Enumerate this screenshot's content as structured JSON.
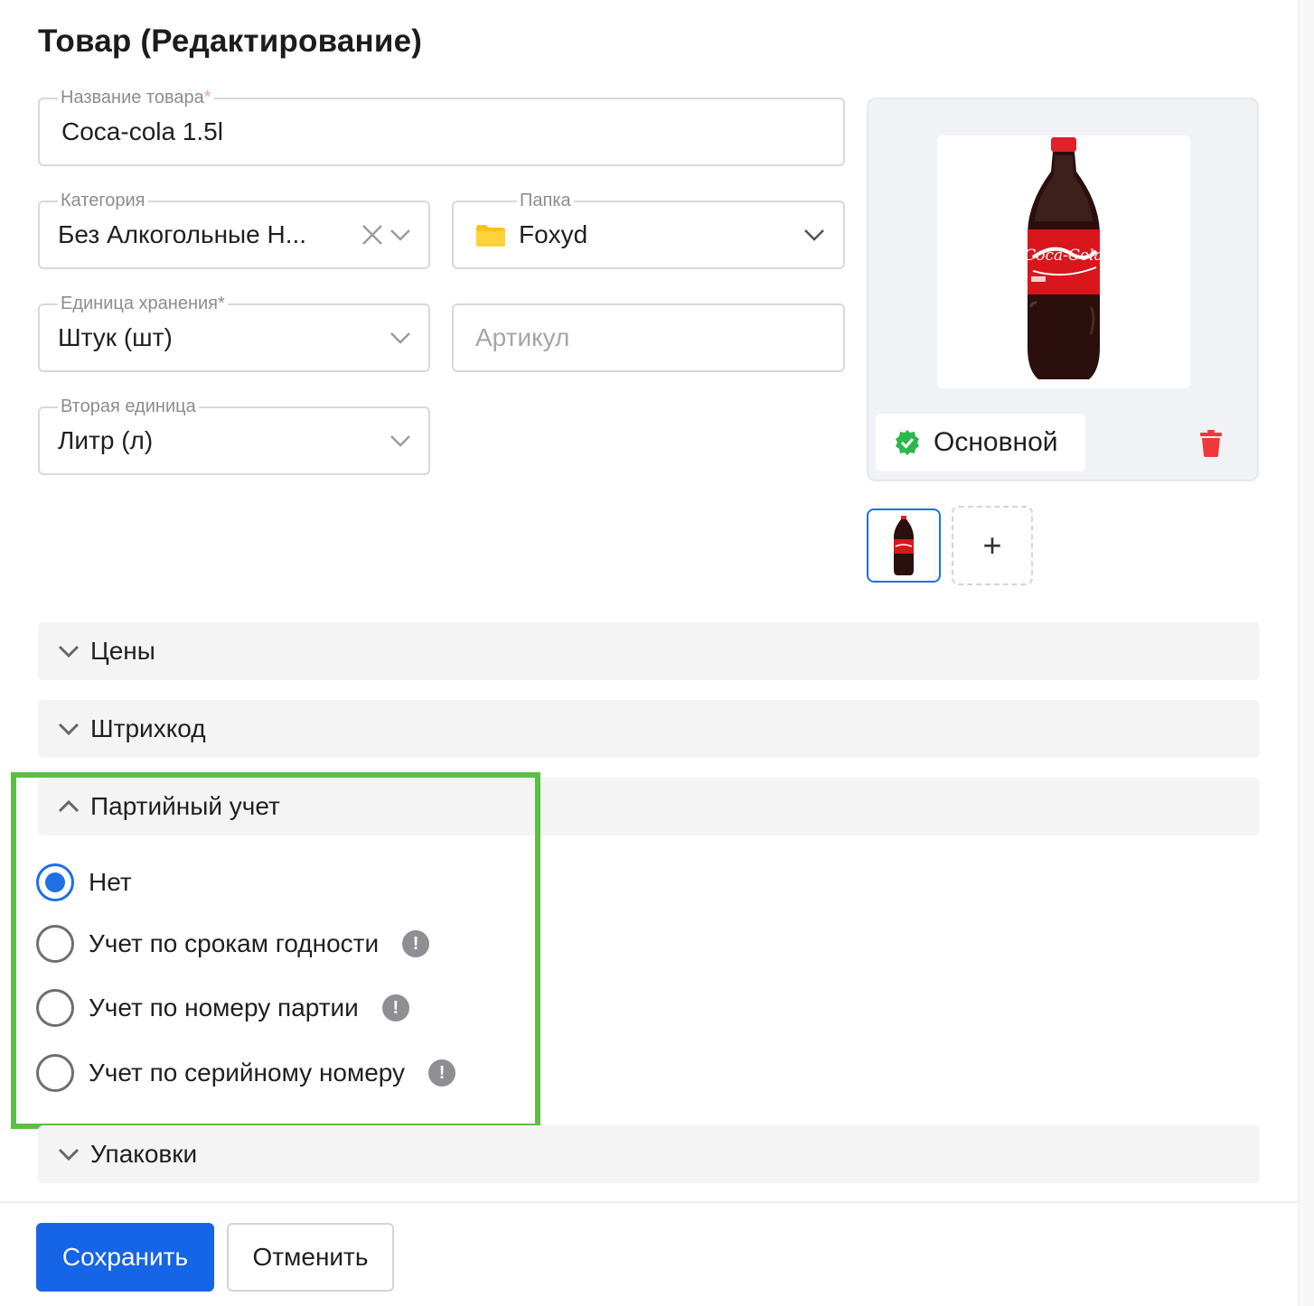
{
  "page": {
    "title": "Товар (Редактирование)"
  },
  "form": {
    "product_name": {
      "label": "Название товара",
      "required_mark": "*",
      "value": "Coca-cola 1.5l"
    },
    "category": {
      "label": "Категория",
      "value": "Без Алкогольные Н..."
    },
    "folder": {
      "label": "Папка",
      "value": "Foxyd",
      "icon": "folder-icon"
    },
    "storage_unit": {
      "label": "Единица хранения",
      "required_mark": "*",
      "value": "Штук (шт)"
    },
    "article": {
      "placeholder": "Артикул",
      "value": ""
    },
    "second_unit": {
      "label": "Вторая единица",
      "value": "Литр (л)"
    }
  },
  "images": {
    "main_badge": "Основной",
    "add_label": "+"
  },
  "sections": [
    {
      "label": "Цены",
      "expanded": false
    },
    {
      "label": "Штрихкод",
      "expanded": false
    },
    {
      "label": "Партийный учет",
      "expanded": true
    },
    {
      "label": "Упаковки",
      "expanded": false
    }
  ],
  "batch_accounting": {
    "options": [
      {
        "label": "Нет",
        "selected": true,
        "info": false
      },
      {
        "label": "Учет по срокам годности",
        "selected": false,
        "info": true
      },
      {
        "label": "Учет по номеру партии",
        "selected": false,
        "info": true
      },
      {
        "label": "Учет по серийному номеру",
        "selected": false,
        "info": true
      }
    ],
    "info_glyph": "!"
  },
  "footer": {
    "save_label": "Сохранить",
    "cancel_label": "Отменить"
  },
  "colors": {
    "primary": "#1565e6",
    "highlight": "#5dbe45",
    "danger": "#f0383c",
    "success": "#2db84d",
    "folder": "#fcc21b"
  }
}
